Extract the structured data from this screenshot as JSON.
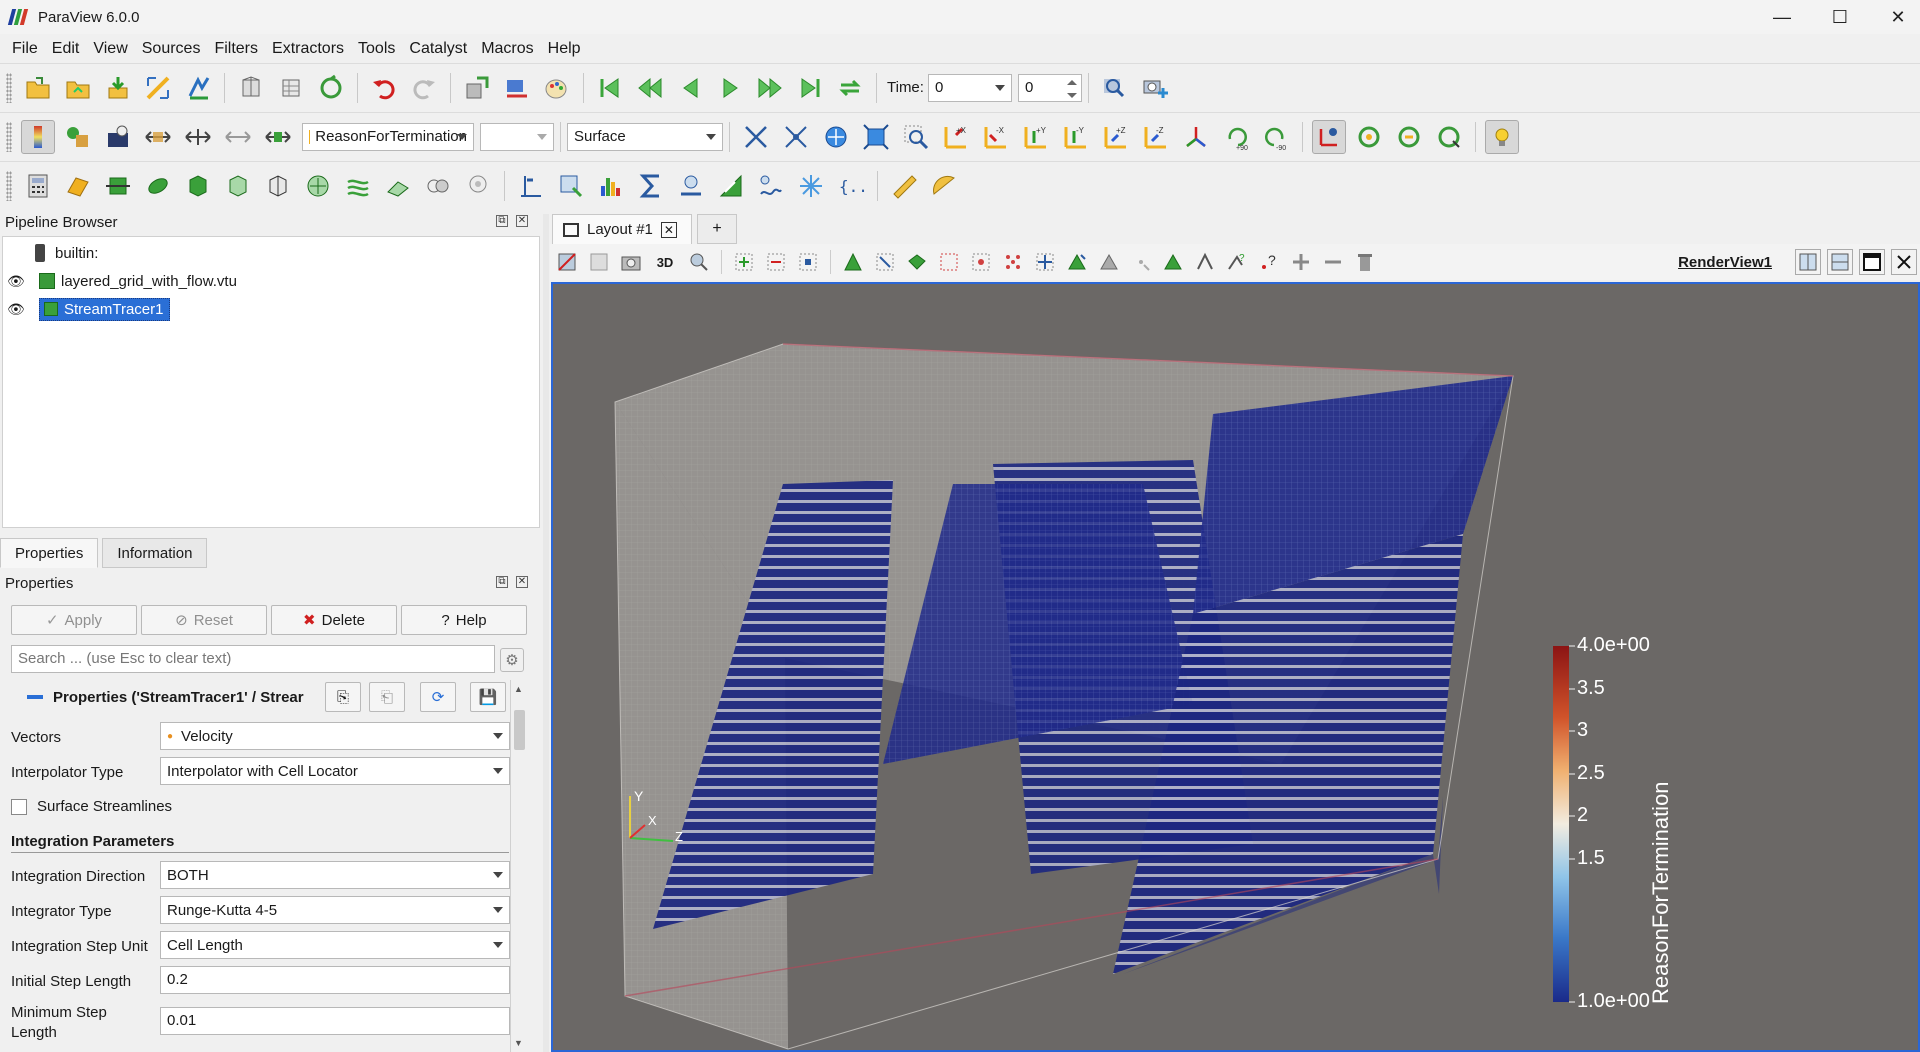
{
  "window": {
    "title": "ParaView 6.0.0",
    "minimize": "—",
    "maximize": "☐",
    "close": "✕"
  },
  "menu": [
    "File",
    "Edit",
    "View",
    "Sources",
    "Filters",
    "Extractors",
    "Tools",
    "Catalyst",
    "Macros",
    "Help"
  ],
  "time": {
    "label": "Time:",
    "value": "0",
    "step": "0"
  },
  "coloring": {
    "array": "ReasonForTermination",
    "component": "",
    "representation": "Surface"
  },
  "pipeline_browser": {
    "title": "Pipeline Browser",
    "items": [
      {
        "label": "builtin:",
        "visible": false
      },
      {
        "label": "layered_grid_with_flow.vtu",
        "visible": true
      },
      {
        "label": "StreamTracer1",
        "visible": true,
        "selected": true
      }
    ]
  },
  "tabs": {
    "properties": "Properties",
    "information": "Information"
  },
  "properties": {
    "title": "Properties",
    "apply": "Apply",
    "reset": "Reset",
    "delete": "Delete",
    "help": "Help",
    "search_placeholder": "Search ... (use Esc to clear text)",
    "section_header": "Properties ('StreamTracer1' / Strear",
    "vectors_label": "Vectors",
    "vectors_value": "Velocity",
    "interpolator_label": "Interpolator Type",
    "interpolator_value": "Interpolator with Cell Locator",
    "surface_streamlines": "Surface Streamlines",
    "integration_params": "Integration Parameters",
    "direction_label": "Integration Direction",
    "direction_value": "BOTH",
    "integrator_label": "Integrator Type",
    "integrator_value": "Runge-Kutta 4-5",
    "step_unit_label": "Integration Step Unit",
    "step_unit_value": "Cell Length",
    "initial_step_label": "Initial Step Length",
    "initial_step_value": "0.2",
    "min_step_label_1": "Minimum Step",
    "min_step_label_2": "Length",
    "min_step_value": "0.01"
  },
  "layout": {
    "tab": "Layout #1",
    "plus": "+",
    "view_name": "RenderView1",
    "mode_3d": "3D"
  },
  "axes": {
    "x": "X",
    "y": "Y",
    "z": "Z"
  },
  "colorbar": {
    "title": "ReasonForTermination",
    "labels": [
      "4.0e+00",
      "3.5",
      "3",
      "2.5",
      "2",
      "1.5",
      "1.0e+00"
    ],
    "colors": [
      "#8c1414",
      "#d0532a",
      "#f0b070",
      "#f2ece0",
      "#8fc4e8",
      "#3a78c8",
      "#1a2a8a"
    ]
  },
  "colors": {
    "accent": "#2a66d6",
    "selection": "#2a6fd6",
    "viewport_bg": "#6b6866",
    "volume_blue": "#1c2680"
  }
}
